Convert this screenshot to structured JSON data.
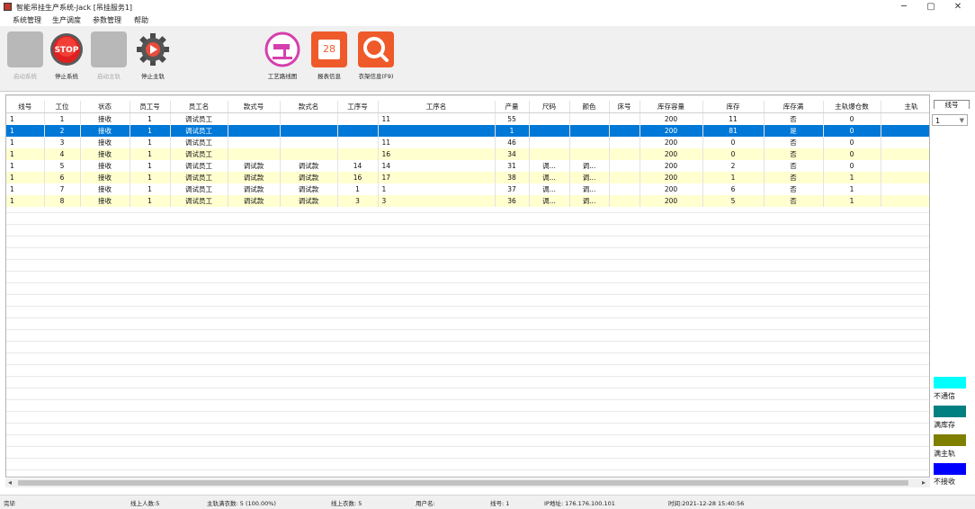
{
  "window": {
    "title": "智能吊挂生产系统-Jack [吊挂服务1]",
    "minimize": "─",
    "maximize": "▢",
    "close": "✕"
  },
  "menu": [
    "系统管理",
    "生产调度",
    "参数管理",
    "帮助"
  ],
  "toolbar": {
    "start_system": "启动系统",
    "stop_system": "停止系统",
    "start_master": "启动主轨",
    "stop_master": "停止主轨",
    "process_route": "工艺路线图",
    "report_query": "报表信息",
    "clothing_search": "衣架信息(F9)",
    "calendar_day": "28",
    "stop_badge": "STOP"
  },
  "grid": {
    "columns": [
      "线号",
      "工位",
      "状态",
      "员工号",
      "员工名",
      "款式号",
      "款式名",
      "工序号",
      "工序名",
      "产量",
      "尺码",
      "颜色",
      "床号",
      "库存容量",
      "库存",
      "库存满",
      "主轨爆仓数",
      "主轨"
    ],
    "rows": [
      {
        "style": "white",
        "cells": [
          "1",
          "1",
          "接收",
          "1",
          "调试员工",
          "",
          "",
          "",
          "11",
          "55",
          "",
          "",
          "",
          "200",
          "11",
          "否",
          "0",
          ""
        ]
      },
      {
        "style": "sel",
        "cells": [
          "1",
          "2",
          "接收",
          "1",
          "调试员工",
          "",
          "",
          "",
          "",
          "1",
          "",
          "",
          "",
          "200",
          "81",
          "是",
          "0",
          ""
        ]
      },
      {
        "style": "white",
        "cells": [
          "1",
          "3",
          "接收",
          "1",
          "调试员工",
          "",
          "",
          "",
          "11",
          "46",
          "",
          "",
          "",
          "200",
          "0",
          "否",
          "0",
          ""
        ]
      },
      {
        "style": "yellow",
        "cells": [
          "1",
          "4",
          "接收",
          "1",
          "调试员工",
          "",
          "",
          "",
          "16",
          "34",
          "",
          "",
          "",
          "200",
          "0",
          "否",
          "0",
          ""
        ]
      },
      {
        "style": "white",
        "cells": [
          "1",
          "5",
          "接收",
          "1",
          "调试员工",
          "调试款",
          "调试款",
          "14",
          "14",
          "31",
          "调...",
          "调...",
          "",
          "200",
          "2",
          "否",
          "0",
          ""
        ]
      },
      {
        "style": "yellow",
        "cells": [
          "1",
          "6",
          "接收",
          "1",
          "调试员工",
          "调试款",
          "调试款",
          "16",
          "17",
          "38",
          "调...",
          "调...",
          "",
          "200",
          "1",
          "否",
          "1",
          ""
        ]
      },
      {
        "style": "white",
        "cells": [
          "1",
          "7",
          "接收",
          "1",
          "调试员工",
          "调试款",
          "调试款",
          "1",
          "1",
          "37",
          "调...",
          "调...",
          "",
          "200",
          "6",
          "否",
          "1",
          ""
        ]
      },
      {
        "style": "yellow",
        "cells": [
          "1",
          "8",
          "接收",
          "1",
          "调试员工",
          "调试款",
          "调试款",
          "3",
          "3",
          "36",
          "调...",
          "调...",
          "",
          "200",
          "5",
          "否",
          "1",
          ""
        ]
      }
    ]
  },
  "side": {
    "line_label": "线号",
    "line_value": "1",
    "legend": [
      {
        "label": "不通信",
        "color": "#00ffff"
      },
      {
        "label": "满库存",
        "color": "#008080"
      },
      {
        "label": "满主轨",
        "color": "#808000"
      },
      {
        "label": "不接收",
        "color": "#0000ff"
      }
    ]
  },
  "status": {
    "state": "完毕",
    "online_count": "线上人数:5",
    "master_hangers": "主轨满衣数: 5 (100.00%)",
    "line_hangers": "线上衣数: 5",
    "user": "用户名:",
    "line_no": "线号: 1",
    "ip": "IP地址: 176.176.100.101",
    "time": "时间:2021-12-28 15:40:56"
  }
}
